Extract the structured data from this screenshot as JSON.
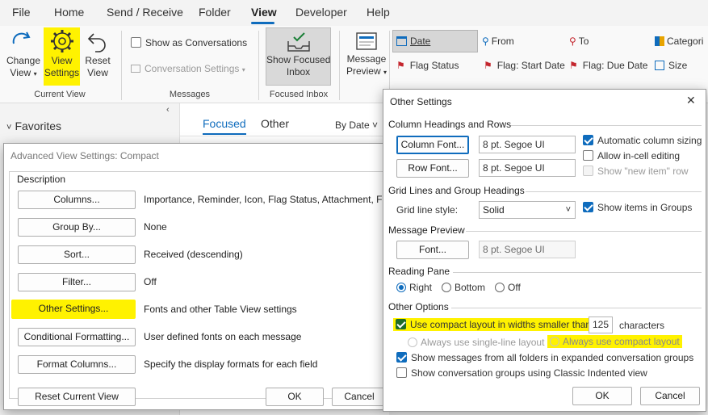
{
  "tabs": [
    "File",
    "Home",
    "Send / Receive",
    "Folder",
    "View",
    "Developer",
    "Help"
  ],
  "ribbon": {
    "change_view": [
      "Change",
      "View"
    ],
    "view_settings": [
      "View",
      "Settings"
    ],
    "reset_view": [
      "Reset",
      "View"
    ],
    "current_view_group": "Current View",
    "show_as_conversations": "Show as Conversations",
    "conversation_settings": "Conversation Settings",
    "messages_group": "Messages",
    "show_focused_inbox": [
      "Show Focused",
      "Inbox"
    ],
    "focused_inbox_group": "Focused Inbox",
    "message_preview": [
      "Message",
      "Preview"
    ],
    "arrange": [
      "Date",
      "From",
      "To",
      "Categori",
      "Flag Status",
      "Flag: Start Date",
      "Flag: Due Date",
      "Size"
    ]
  },
  "navpane": {
    "favorites": "Favorites"
  },
  "listpane": {
    "focused": "Focused",
    "other": "Other",
    "sort": "By Date"
  },
  "advanced_dialog": {
    "title": "Advanced View Settings: Compact",
    "section": "Description",
    "rows": [
      {
        "button": "Columns...",
        "desc": "Importance, Reminder, Icon, Flag Status, Attachment, Fr..."
      },
      {
        "button": "Group By...",
        "desc": "None"
      },
      {
        "button": "Sort...",
        "desc": "Received (descending)"
      },
      {
        "button": "Filter...",
        "desc": "Off"
      },
      {
        "button": "Other Settings...",
        "desc": "Fonts and other Table View settings"
      },
      {
        "button": "Conditional Formatting...",
        "desc": "User defined fonts on each message"
      },
      {
        "button": "Format Columns...",
        "desc": "Specify the display formats for each field"
      }
    ],
    "reset": "Reset Current View",
    "ok": "OK",
    "cancel": "Cancel"
  },
  "other_dialog": {
    "title": "Other Settings",
    "close": "✕",
    "col_section": "Column Headings and Rows",
    "column_font": "Column Font...",
    "column_font_value": "8 pt. Segoe UI",
    "row_font": "Row Font...",
    "row_font_value": "8 pt. Segoe UI",
    "auto_col": "Automatic column sizing",
    "allow_incell": "Allow in-cell editing",
    "show_new_item": "Show \"new item\" row",
    "grid_section": "Grid Lines and Group Headings",
    "grid_style_label": "Grid line style:",
    "grid_style_value": "Solid",
    "show_groups": "Show items in Groups",
    "preview_section": "Message Preview",
    "preview_font": "Font...",
    "preview_font_value": "8 pt. Segoe UI",
    "reading_section": "Reading Pane",
    "rp_right": "Right",
    "rp_bottom": "Bottom",
    "rp_off": "Off",
    "other_section": "Other Options",
    "compact_label": "Use compact layout in widths smaller than",
    "compact_width": "125",
    "compact_unit": "characters",
    "single_line": "Always use single-line layout",
    "always_compact": "Always use compact layout",
    "show_all_folders": "Show messages from all folders in expanded conversation groups",
    "classic_indented": "Show conversation groups using Classic Indented view",
    "ok": "OK",
    "cancel": "Cancel"
  },
  "colors": {
    "accent": "#0f6cbd",
    "highlight": "#fff200"
  }
}
